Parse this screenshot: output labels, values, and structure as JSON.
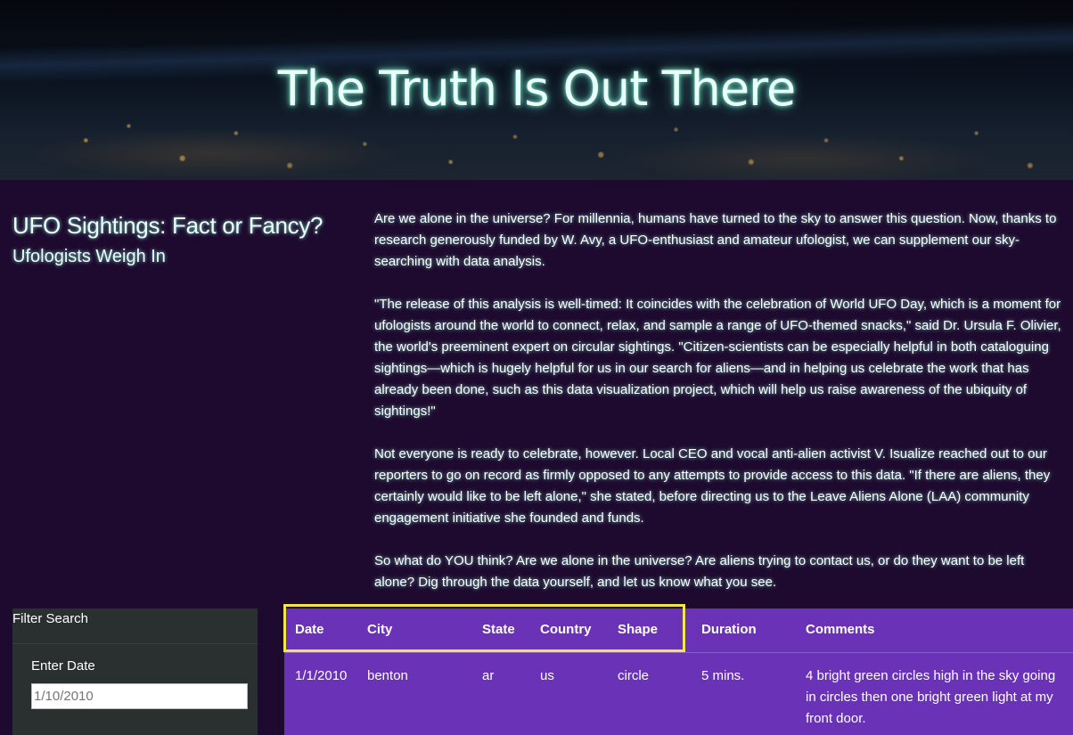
{
  "hero": {
    "title": "The Truth Is Out There"
  },
  "left": {
    "title": "UFO Sightings: Fact or Fancy?",
    "subtitle": "Ufologists Weigh In"
  },
  "article": {
    "paragraphs": [
      "Are we alone in the universe? For millennia, humans have turned to the sky to answer this question. Now, thanks to research generously funded by W. Avy, a UFO-enthusiast and amateur ufologist, we can supplement our sky-searching with data analysis.",
      "\"The release of this analysis is well-timed: It coincides with the celebration of World UFO Day, which is a moment for ufologists around the world to connect, relax, and sample a range of UFO-themed snacks,\" said Dr. Ursula F. Olivier, the world's preeminent expert on circular sightings. \"Citizen-scientists can be especially helpful in both cataloguing sightings—which is hugely helpful for us in our search for aliens—and in helping us celebrate the work that has already been done, such as this data visualization project, which will help us raise awareness of the ubiquity of sightings!\"",
      "Not everyone is ready to celebrate, however. Local CEO and vocal anti-alien activist V. Isualize reached out to our reporters to go on record as firmly opposed to any attempts to provide access to this data. \"If there are aliens, they certainly would like to be left alone,\" she stated, before directing us to the Leave Aliens Alone (LAA) community engagement initiative she founded and funds.",
      "So what do YOU think? Are we alone in the universe? Are aliens trying to contact us, or do they want to be left alone? Dig through the data yourself, and let us know what you see."
    ]
  },
  "filter": {
    "title": "Filter Search",
    "date_label": "Enter Date",
    "date_placeholder": "1/10/2010"
  },
  "table": {
    "headers": [
      "Date",
      "City",
      "State",
      "Country",
      "Shape",
      "Duration",
      "Comments"
    ],
    "rows": [
      [
        "1/1/2010",
        "benton",
        "ar",
        "us",
        "circle",
        "5 mins.",
        "4 bright green circles high in the sky going in circles then one bright green light at my front door."
      ]
    ]
  },
  "colors": {
    "page_bg": "#1d0a2e",
    "table_bg": "#6a32b6",
    "filter_bg": "#2a302f",
    "highlight": "#f3e64d",
    "glow": "#7fffe0"
  }
}
